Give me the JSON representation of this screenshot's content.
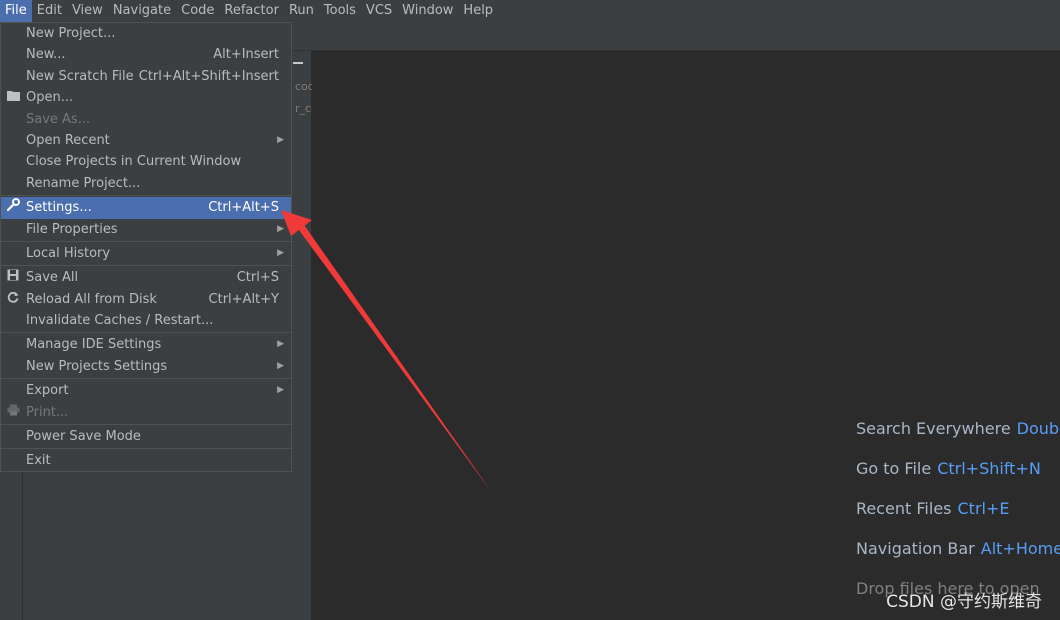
{
  "menubar": [
    {
      "label": "File",
      "active": true
    },
    {
      "label": "Edit"
    },
    {
      "label": "View"
    },
    {
      "label": "Navigate"
    },
    {
      "label": "Code"
    },
    {
      "label": "Refactor"
    },
    {
      "label": "Run"
    },
    {
      "label": "Tools"
    },
    {
      "label": "VCS"
    },
    {
      "label": "Window"
    },
    {
      "label": "Help"
    }
  ],
  "project_fragments": [
    "cod",
    "r_co"
  ],
  "file_menu": [
    {
      "label": "New Project...",
      "shortcut": ""
    },
    {
      "label": "New...",
      "shortcut": "Alt+Insert"
    },
    {
      "label": "New Scratch File",
      "shortcut": "Ctrl+Alt+Shift+Insert"
    },
    {
      "label": "Open...",
      "shortcut": "",
      "icon": "folder-icon"
    },
    {
      "label": "Save As...",
      "shortcut": "",
      "disabled": true
    },
    {
      "label": "Open Recent",
      "shortcut": "",
      "submenu": true
    },
    {
      "label": "Close Projects in Current Window",
      "shortcut": ""
    },
    {
      "label": "Rename Project...",
      "shortcut": ""
    },
    {
      "separator": true
    },
    {
      "label": "Settings...",
      "shortcut": "Ctrl+Alt+S",
      "icon": "wrench-icon",
      "selected": true
    },
    {
      "label": "File Properties",
      "shortcut": "",
      "submenu": true
    },
    {
      "separator": true
    },
    {
      "label": "Local History",
      "shortcut": "",
      "submenu": true
    },
    {
      "separator": true
    },
    {
      "label": "Save All",
      "shortcut": "Ctrl+S",
      "icon": "save-icon"
    },
    {
      "label": "Reload All from Disk",
      "shortcut": "Ctrl+Alt+Y",
      "icon": "reload-icon"
    },
    {
      "label": "Invalidate Caches / Restart...",
      "shortcut": ""
    },
    {
      "separator": true
    },
    {
      "label": "Manage IDE Settings",
      "shortcut": "",
      "submenu": true
    },
    {
      "label": "New Projects Settings",
      "shortcut": "",
      "submenu": true
    },
    {
      "separator": true
    },
    {
      "label": "Export",
      "shortcut": "",
      "submenu": true
    },
    {
      "label": "Print...",
      "shortcut": "",
      "icon": "printer-icon",
      "disabled": true
    },
    {
      "separator": true
    },
    {
      "label": "Power Save Mode",
      "shortcut": ""
    },
    {
      "separator": true
    },
    {
      "label": "Exit",
      "shortcut": ""
    }
  ],
  "editor_hints": [
    {
      "label": "Search Everywhere",
      "key": "Doubl"
    },
    {
      "label": "Go to File",
      "key": "Ctrl+Shift+N"
    },
    {
      "label": "Recent Files",
      "key": "Ctrl+E"
    },
    {
      "label": "Navigation Bar",
      "key": "Alt+Home"
    },
    {
      "label": "Drop files here to open",
      "key": ""
    }
  ],
  "watermark": "CSDN @守约斯维奇",
  "colors": {
    "selection": "#4b6eaf",
    "shortcut_key": "#589df6",
    "annotation_arrow": "#f03a3a"
  }
}
